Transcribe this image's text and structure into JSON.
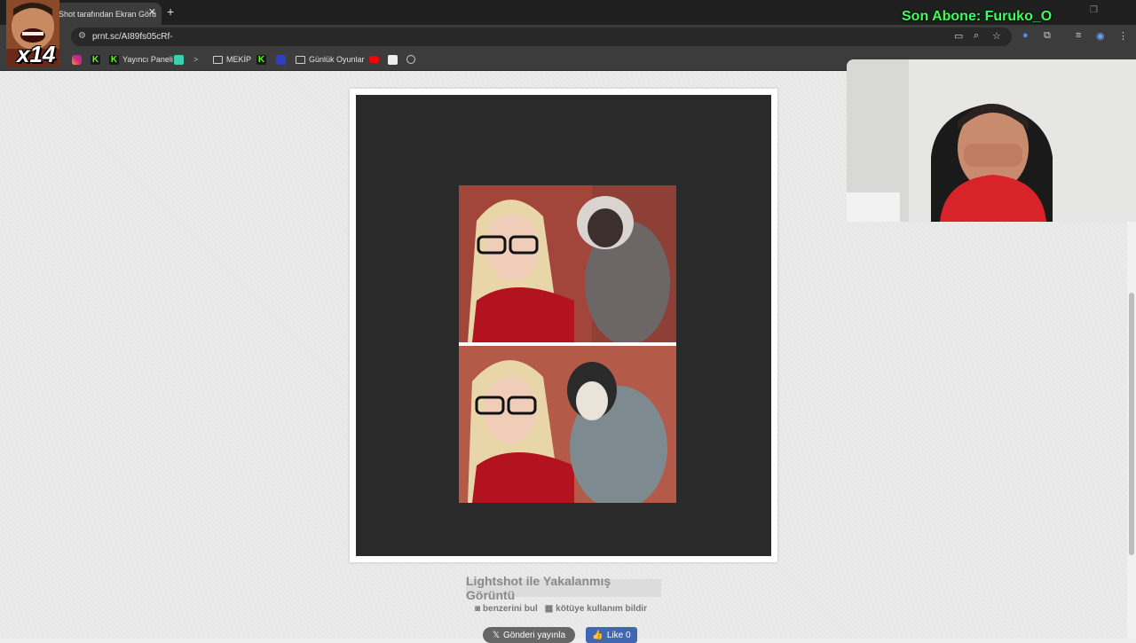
{
  "browser": {
    "tab_title": "Shot tarafından Ekran Görü",
    "tab_close": "✕",
    "new_tab": "+",
    "url": "prnt.sc/AI89fs05cRf-",
    "bookmarks": [
      {
        "label": "",
        "icon": "x-icon"
      },
      {
        "label": "",
        "icon": "instagram-icon"
      },
      {
        "label": "",
        "icon": "kick-icon"
      },
      {
        "label": "Yayıncı Paneli",
        "icon": "kick-icon"
      },
      {
        "label": "",
        "icon": "app-icon"
      },
      {
        "label": "",
        "icon": "arrow-icon"
      },
      {
        "label": "MEKİP",
        "icon": "folder-icon"
      },
      {
        "label": "",
        "icon": "kick-icon"
      },
      {
        "label": "",
        "icon": "app-icon"
      },
      {
        "label": "Günlük Oyunlar",
        "icon": "folder-icon"
      },
      {
        "label": "",
        "icon": "youtube-icon"
      },
      {
        "label": "",
        "icon": "gamepad-icon"
      },
      {
        "label": "",
        "icon": "globe-icon"
      }
    ]
  },
  "page": {
    "caption": "Lightshot ile Yakalanmış Görüntü",
    "find_similar": "benzerini bul",
    "report_abuse": "kötüye kullanım bildir",
    "post_button": "Gönderi yayınla",
    "like_button": "Like 0"
  },
  "overlay": {
    "last_subscriber": "Son Abone: Furuko_O",
    "emote_label": "x14"
  },
  "colors": {
    "chrome_dark": "#1f1f1f",
    "toolbar": "#3c3c3c",
    "screenshot_bg": "#2a2a2a",
    "subscriber_text": "#3dff5a",
    "like_blue": "#4267b2"
  }
}
